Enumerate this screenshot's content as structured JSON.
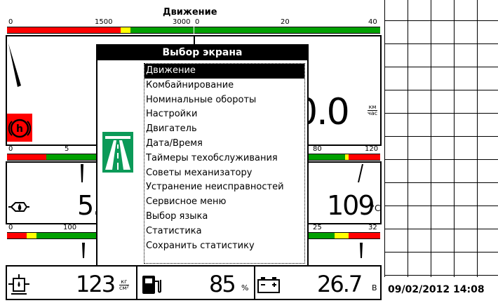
{
  "header": {
    "title": "Движение"
  },
  "top_left_scale": {
    "ticks": [
      "0",
      "1500",
      "3000"
    ]
  },
  "top_right_scale": {
    "ticks": [
      "0",
      "20",
      "40"
    ]
  },
  "speed": {
    "value": "0.0",
    "unit_top": "км",
    "unit_bottom": "час"
  },
  "left_mid_scale": {
    "ticks": [
      "0",
      "5"
    ]
  },
  "right_mid_scale": {
    "ticks": [
      "80",
      "120"
    ]
  },
  "oil_pressure": {
    "value": "5."
  },
  "coolant_temp": {
    "value": "109",
    "unit": "°C"
  },
  "left_low_scale": {
    "ticks": [
      "0",
      "100"
    ]
  },
  "right_low_scale": {
    "ticks": [
      "25",
      "32"
    ]
  },
  "hydraulic_pressure": {
    "value": "123",
    "unit_top": "кг",
    "unit_bottom": "см²"
  },
  "fuel": {
    "value": "85",
    "unit": "%"
  },
  "battery": {
    "value": "26.7",
    "unit": "В"
  },
  "datetime": "09/02/2012 14:08",
  "dialog": {
    "title": "Выбор экрана",
    "items": [
      "Движение",
      "Комбайнирование",
      "Номинальные обороты",
      "Настройки",
      "Двигатель",
      "Дата/Время",
      "Таймеры техобслуживания",
      "Советы механизатору",
      "Устранение неисправностей",
      "Сервисное меню",
      "Выбор языка",
      "Статистика",
      "Сохранить статистику"
    ],
    "selected_index": 0
  },
  "colors": {
    "red": "#ff0000",
    "yellow": "#ffff00",
    "green": "#00a000",
    "road_green": "#0b9a58"
  }
}
